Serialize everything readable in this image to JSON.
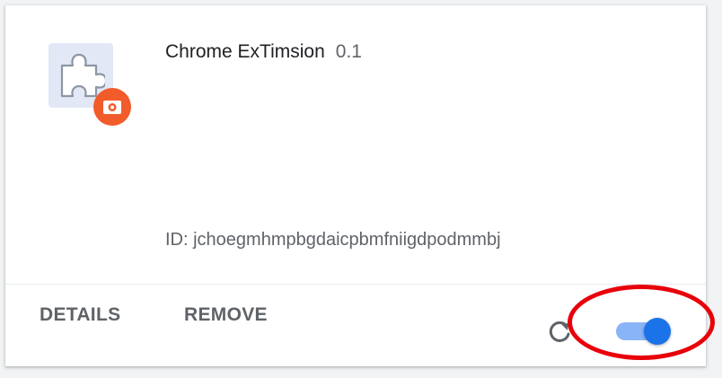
{
  "extension": {
    "name": "Chrome ExTimsion",
    "version": "0.1",
    "id_text": "ID: jchoegmhmpbgdaicpbmfniigdpodmmbj",
    "icon": "puzzle-piece-icon",
    "badge_icon": "camera-icon",
    "enabled": true
  },
  "actions": {
    "details_label": "DETAILS",
    "remove_label": "REMOVE",
    "reload_icon": "reload-icon"
  },
  "colors": {
    "toggle_knob": "#1a73e8",
    "toggle_track": "#8ab4f8",
    "badge": "#f25b2a",
    "highlight": "#e8000b"
  }
}
